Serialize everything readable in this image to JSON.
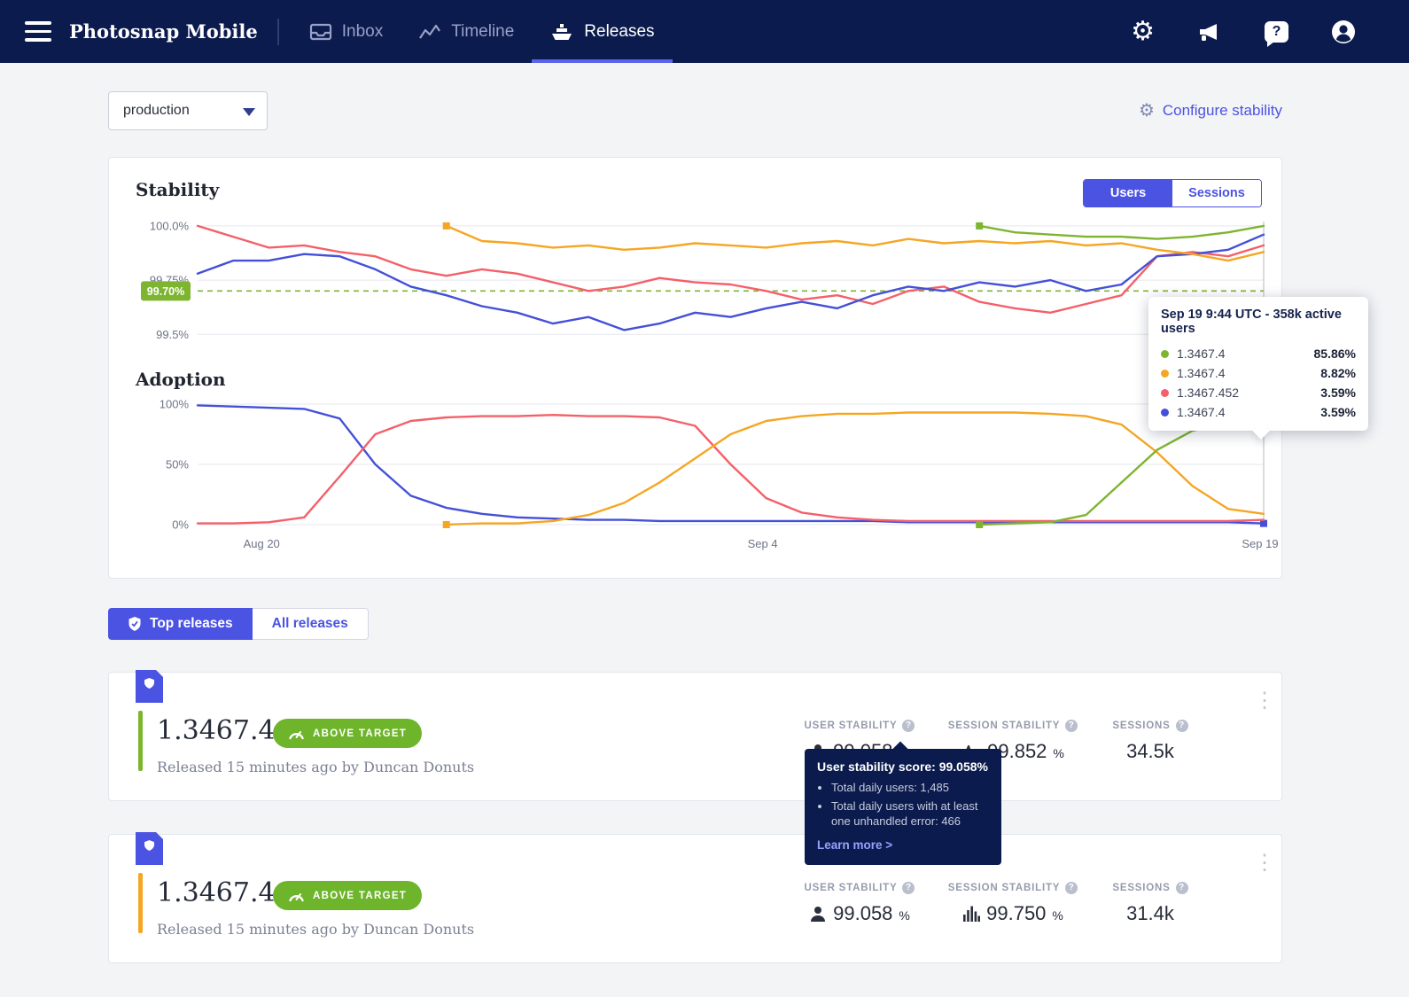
{
  "nav": {
    "title": "Photosnap Mobile",
    "tabs": [
      {
        "label": "Inbox"
      },
      {
        "label": "Timeline"
      },
      {
        "label": "Releases"
      }
    ]
  },
  "controls": {
    "environment": "production",
    "configure_label": "Configure stability"
  },
  "stability_section": {
    "title": "Stability",
    "toggle_users": "Users",
    "toggle_sessions": "Sessions"
  },
  "adoption_section": {
    "title": "Adoption"
  },
  "chart_tooltip": {
    "title": "Sep 19 9:44 UTC - 358k active users",
    "rows": [
      {
        "name": "1.3467.4",
        "value": "85.86%",
        "color": "#7db530"
      },
      {
        "name": "1.3467.4",
        "value": "8.82%",
        "color": "#f5a623"
      },
      {
        "name": "1.3467.452",
        "value": "3.59%",
        "color": "#f4606a"
      },
      {
        "name": "1.3467.4",
        "value": "3.59%",
        "color": "#4450d8"
      }
    ]
  },
  "chart_data": [
    {
      "type": "line",
      "title": "Stability",
      "xlabel": "",
      "ylabel": "",
      "x_range": [
        0,
        30
      ],
      "ylim": [
        99.44,
        100.02
      ],
      "yticks": [
        {
          "label": "100.0%",
          "value": 100.0
        },
        {
          "label": "99.75%",
          "value": 99.75
        },
        {
          "label": "99.5%",
          "value": 99.5
        }
      ],
      "threshold": {
        "value": 99.7,
        "label": "99.70%",
        "color": "#7db530"
      },
      "crosshair_x": 30,
      "series": [
        {
          "name": "1.3467.452",
          "color": "#f4606a",
          "values": [
            [
              0,
              100
            ],
            [
              1,
              99.95
            ],
            [
              2,
              99.9
            ],
            [
              3,
              99.91
            ],
            [
              4,
              99.88
            ],
            [
              5,
              99.86
            ],
            [
              6,
              99.8
            ],
            [
              7,
              99.77
            ],
            [
              8,
              99.8
            ],
            [
              9,
              99.78
            ],
            [
              10,
              99.74
            ],
            [
              11,
              99.7
            ],
            [
              12,
              99.72
            ],
            [
              13,
              99.76
            ],
            [
              14,
              99.74
            ],
            [
              15,
              99.73
            ],
            [
              16,
              99.7
            ],
            [
              17,
              99.66
            ],
            [
              18,
              99.68
            ],
            [
              19,
              99.64
            ],
            [
              20,
              99.7
            ],
            [
              21,
              99.72
            ],
            [
              22,
              99.65
            ],
            [
              23,
              99.62
            ],
            [
              24,
              99.6
            ],
            [
              25,
              99.64
            ],
            [
              26,
              99.68
            ],
            [
              27,
              99.86
            ],
            [
              28,
              99.88
            ],
            [
              29,
              99.86
            ],
            [
              30,
              99.91
            ]
          ]
        },
        {
          "name": "1.3467.4",
          "color": "#4450d8",
          "values": [
            [
              0,
              99.78
            ],
            [
              1,
              99.84
            ],
            [
              2,
              99.84
            ],
            [
              3,
              99.87
            ],
            [
              4,
              99.86
            ],
            [
              5,
              99.8
            ],
            [
              6,
              99.72
            ],
            [
              7,
              99.68
            ],
            [
              8,
              99.63
            ],
            [
              9,
              99.6
            ],
            [
              10,
              99.55
            ],
            [
              11,
              99.58
            ],
            [
              12,
              99.52
            ],
            [
              13,
              99.55
            ],
            [
              14,
              99.6
            ],
            [
              15,
              99.58
            ],
            [
              16,
              99.62
            ],
            [
              17,
              99.65
            ],
            [
              18,
              99.62
            ],
            [
              19,
              99.68
            ],
            [
              20,
              99.72
            ],
            [
              21,
              99.7
            ],
            [
              22,
              99.74
            ],
            [
              23,
              99.72
            ],
            [
              24,
              99.75
            ],
            [
              25,
              99.7
            ],
            [
              26,
              99.73
            ],
            [
              27,
              99.86
            ],
            [
              28,
              99.87
            ],
            [
              29,
              99.89
            ],
            [
              30,
              99.96
            ]
          ]
        },
        {
          "name": "1.3467.4",
          "color": "#f5a623",
          "values": [
            [
              7,
              100
            ],
            [
              8,
              99.93
            ],
            [
              9,
              99.92
            ],
            [
              10,
              99.9
            ],
            [
              11,
              99.91
            ],
            [
              12,
              99.89
            ],
            [
              13,
              99.9
            ],
            [
              14,
              99.92
            ],
            [
              15,
              99.91
            ],
            [
              16,
              99.9
            ],
            [
              17,
              99.92
            ],
            [
              18,
              99.93
            ],
            [
              19,
              99.91
            ],
            [
              20,
              99.94
            ],
            [
              21,
              99.92
            ],
            [
              22,
              99.93
            ],
            [
              23,
              99.92
            ],
            [
              24,
              99.93
            ],
            [
              25,
              99.91
            ],
            [
              26,
              99.92
            ],
            [
              27,
              99.89
            ],
            [
              28,
              99.87
            ],
            [
              29,
              99.84
            ],
            [
              30,
              99.88
            ]
          ],
          "markers": [
            [
              7,
              100
            ]
          ]
        },
        {
          "name": "1.3467.4",
          "color": "#7db530",
          "values": [
            [
              22,
              100
            ],
            [
              23,
              99.97
            ],
            [
              24,
              99.96
            ],
            [
              25,
              99.95
            ],
            [
              26,
              99.95
            ],
            [
              27,
              99.94
            ],
            [
              28,
              99.95
            ],
            [
              29,
              99.97
            ],
            [
              30,
              100
            ]
          ],
          "markers": [
            [
              22,
              100
            ]
          ]
        }
      ]
    },
    {
      "type": "line",
      "title": "Adoption",
      "xlabel": "",
      "ylabel": "",
      "x_range": [
        0,
        30
      ],
      "ylim": [
        0,
        100
      ],
      "yticks": [
        {
          "label": "100%",
          "value": 100
        },
        {
          "label": "50%",
          "value": 50
        },
        {
          "label": "0%",
          "value": 0
        }
      ],
      "xticks": [
        {
          "label": "Aug 20",
          "value": 1.8
        },
        {
          "label": "Sep 4",
          "value": 15.9
        },
        {
          "label": "Sep 19",
          "value": 29.9
        }
      ],
      "crosshair_x": 30,
      "series": [
        {
          "name": "1.3467.4",
          "color": "#4450d8",
          "values": [
            [
              0,
              99
            ],
            [
              1,
              98
            ],
            [
              2,
              97
            ],
            [
              3,
              96
            ],
            [
              4,
              88
            ],
            [
              5,
              50
            ],
            [
              6,
              24
            ],
            [
              7,
              14
            ],
            [
              8,
              9
            ],
            [
              9,
              6
            ],
            [
              10,
              5
            ],
            [
              11,
              4
            ],
            [
              12,
              4
            ],
            [
              13,
              3
            ],
            [
              14,
              3
            ],
            [
              15,
              3
            ],
            [
              16,
              3
            ],
            [
              17,
              3
            ],
            [
              18,
              3
            ],
            [
              19,
              3
            ],
            [
              20,
              2
            ],
            [
              21,
              2
            ],
            [
              22,
              2
            ],
            [
              23,
              2
            ],
            [
              24,
              2
            ],
            [
              25,
              2
            ],
            [
              26,
              2
            ],
            [
              27,
              2
            ],
            [
              28,
              2
            ],
            [
              29,
              2
            ],
            [
              30,
              1
            ]
          ],
          "markers": [
            [
              30,
              1
            ]
          ]
        },
        {
          "name": "1.3467.452",
          "color": "#f4606a",
          "values": [
            [
              0,
              1
            ],
            [
              1,
              1
            ],
            [
              2,
              2
            ],
            [
              3,
              6
            ],
            [
              4,
              40
            ],
            [
              5,
              75
            ],
            [
              6,
              86
            ],
            [
              7,
              89
            ],
            [
              8,
              90
            ],
            [
              9,
              90
            ],
            [
              10,
              91
            ],
            [
              11,
              90
            ],
            [
              12,
              90
            ],
            [
              13,
              89
            ],
            [
              14,
              82
            ],
            [
              15,
              50
            ],
            [
              16,
              22
            ],
            [
              17,
              10
            ],
            [
              18,
              6
            ],
            [
              19,
              4
            ],
            [
              20,
              3
            ],
            [
              21,
              3
            ],
            [
              22,
              3
            ],
            [
              23,
              3
            ],
            [
              24,
              3
            ],
            [
              25,
              3
            ],
            [
              26,
              3
            ],
            [
              27,
              3
            ],
            [
              28,
              3
            ],
            [
              29,
              3
            ],
            [
              30,
              4
            ]
          ]
        },
        {
          "name": "1.3467.4",
          "color": "#f5a623",
          "values": [
            [
              7,
              0
            ],
            [
              8,
              1
            ],
            [
              9,
              1
            ],
            [
              10,
              3
            ],
            [
              11,
              8
            ],
            [
              12,
              18
            ],
            [
              13,
              35
            ],
            [
              14,
              55
            ],
            [
              15,
              75
            ],
            [
              16,
              86
            ],
            [
              17,
              90
            ],
            [
              18,
              92
            ],
            [
              19,
              92
            ],
            [
              20,
              93
            ],
            [
              21,
              93
            ],
            [
              22,
              93
            ],
            [
              23,
              93
            ],
            [
              24,
              92
            ],
            [
              25,
              90
            ],
            [
              26,
              83
            ],
            [
              27,
              60
            ],
            [
              28,
              32
            ],
            [
              29,
              13
            ],
            [
              30,
              9
            ]
          ],
          "markers": [
            [
              7,
              0
            ]
          ]
        },
        {
          "name": "1.3467.4",
          "color": "#7db530",
          "values": [
            [
              22,
              0
            ],
            [
              23,
              1
            ],
            [
              24,
              2
            ],
            [
              25,
              8
            ],
            [
              26,
              35
            ],
            [
              27,
              62
            ],
            [
              28,
              78
            ],
            [
              29,
              84
            ],
            [
              30,
              86
            ]
          ],
          "markers": [
            [
              22,
              0
            ]
          ]
        }
      ]
    }
  ],
  "releases_toggle": {
    "top": "Top releases",
    "all": "All releases"
  },
  "releases": [
    {
      "version": "1.3467.4",
      "badge": "ABOVE TARGET",
      "released": "Released 15 minutes ago by Duncan Donuts",
      "accent_color": "#7db530",
      "stats": {
        "user_label": "USER STABILITY",
        "user_value": "99.058",
        "user_unit": "%",
        "session_label": "SESSION STABILITY",
        "session_value": "99.852",
        "session_unit": "%",
        "sessions_label": "SESSIONS",
        "sessions_value": "34.5k"
      }
    },
    {
      "version": "1.3467.4",
      "badge": "ABOVE TARGET",
      "released": "Released 15 minutes ago by Duncan Donuts",
      "accent_color": "#f5a623",
      "stats": {
        "user_label": "USER STABILITY",
        "user_value": "99.058",
        "user_unit": "%",
        "session_label": "SESSION STABILITY",
        "session_value": "99.750",
        "session_unit": "%",
        "sessions_label": "SESSIONS",
        "sessions_value": "31.4k"
      }
    }
  ],
  "stability_tooltip": {
    "title": "User stability score: 99.058%",
    "bullets": [
      "Total daily users: 1,485",
      "Total daily users with at least one unhandled error: 466"
    ],
    "link": "Learn more >"
  }
}
